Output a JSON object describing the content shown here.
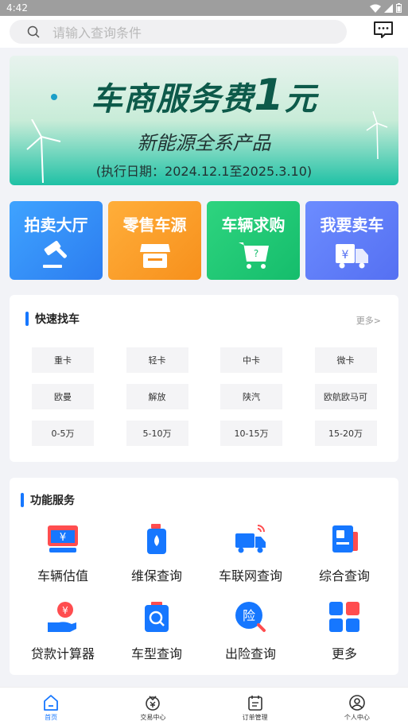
{
  "status_bar": {
    "time": "4:42"
  },
  "search": {
    "placeholder": "请输入查询条件"
  },
  "banner": {
    "title_main": "车商服务费",
    "title_num": "1",
    "title_unit": "元",
    "subtitle": "新能源全系产品",
    "date": "(执行日期：2024.12.1至2025.3.10)"
  },
  "tiles": [
    {
      "label": "拍卖大厅",
      "icon": "gavel-icon"
    },
    {
      "label": "零售车源",
      "icon": "store-icon"
    },
    {
      "label": "车辆求购",
      "icon": "cart-icon"
    },
    {
      "label": "我要卖车",
      "icon": "truck-yuan-icon"
    }
  ],
  "quick_find": {
    "title": "快速找车",
    "more": "更多>",
    "chips": [
      "重卡",
      "轻卡",
      "中卡",
      "微卡",
      "欧曼",
      "解放",
      "陕汽",
      "欧航欧马可",
      "0-5万",
      "5-10万",
      "10-15万",
      "15-20万"
    ]
  },
  "functions": {
    "title": "功能服务",
    "items": [
      {
        "label": "车辆估值",
        "icon": "valuation-icon"
      },
      {
        "label": "维保查询",
        "icon": "maintenance-icon"
      },
      {
        "label": "车联网查询",
        "icon": "iov-icon"
      },
      {
        "label": "综合查询",
        "icon": "comprehensive-icon"
      },
      {
        "label": "贷款计算器",
        "icon": "loan-calculator-icon"
      },
      {
        "label": "车型查询",
        "icon": "model-search-icon"
      },
      {
        "label": "出险查询",
        "icon": "insurance-claim-icon"
      },
      {
        "label": "更多",
        "icon": "more-grid-icon"
      }
    ]
  },
  "tabbar": [
    {
      "label": "首页",
      "icon": "home-icon",
      "active": true
    },
    {
      "label": "交易中心",
      "icon": "trade-icon",
      "active": false
    },
    {
      "label": "订单管理",
      "icon": "order-icon",
      "active": false
    },
    {
      "label": "个人中心",
      "icon": "profile-icon",
      "active": false
    }
  ],
  "colors": {
    "accent": "#1677ff",
    "tile_blue": "#2c7df0",
    "tile_orange": "#f7901c",
    "tile_green": "#15bd6c",
    "tile_purple": "#5570f2"
  }
}
